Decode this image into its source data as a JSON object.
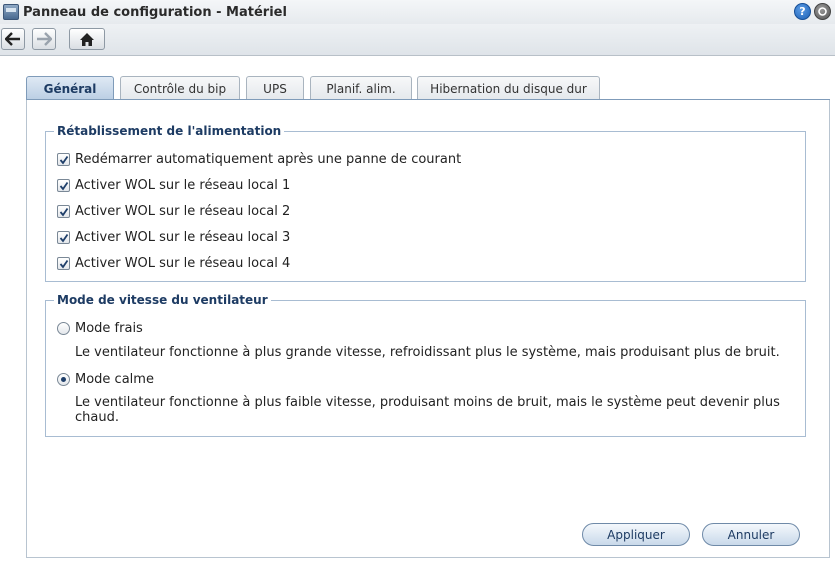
{
  "window": {
    "title": "Panneau de configuration - Matériel"
  },
  "tabs": [
    {
      "label": "Général",
      "active": true
    },
    {
      "label": "Contrôle du bip",
      "active": false
    },
    {
      "label": "UPS",
      "active": false
    },
    {
      "label": "Planif. alim.",
      "active": false
    },
    {
      "label": "Hibernation du disque dur",
      "active": false
    }
  ],
  "power_recovery": {
    "legend": "Rétablissement de l'alimentation",
    "options": [
      {
        "label": "Redémarrer automatiquement après une panne de courant",
        "checked": true
      },
      {
        "label": "Activer WOL sur le réseau local 1",
        "checked": true
      },
      {
        "label": "Activer WOL sur le réseau local 2",
        "checked": true
      },
      {
        "label": "Activer WOL sur le réseau local 3",
        "checked": true
      },
      {
        "label": "Activer WOL sur le réseau local 4",
        "checked": true
      }
    ]
  },
  "fan_mode": {
    "legend": "Mode de vitesse du ventilateur",
    "options": [
      {
        "label": "Mode frais",
        "selected": false,
        "description": "Le ventilateur fonctionne à plus grande vitesse, refroidissant plus le système, mais produisant plus de bruit."
      },
      {
        "label": "Mode calme",
        "selected": true,
        "description": "Le ventilateur fonctionne à plus faible vitesse, produisant moins de bruit, mais le système peut devenir plus chaud."
      }
    ]
  },
  "buttons": {
    "apply": "Appliquer",
    "cancel": "Annuler"
  },
  "title_buttons": {
    "help": "?"
  },
  "colors": {
    "accent": "#1d3b63",
    "tab_active": "#b9cde3",
    "border": "#a8bcd2"
  }
}
